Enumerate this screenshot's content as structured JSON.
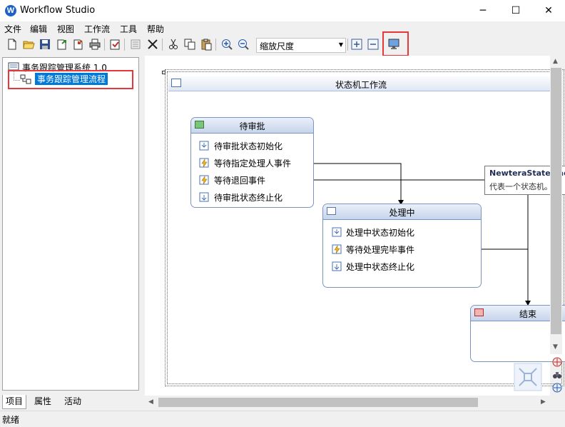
{
  "window": {
    "title": "Workflow Studio",
    "icon_letter": "W",
    "min": "─",
    "max": "☐",
    "close": "✕"
  },
  "menu": {
    "file": "文件",
    "edit": "编辑",
    "view": "视图",
    "workflow": "工作流",
    "tools": "工具",
    "help": "帮助"
  },
  "toolbar": {
    "zoom_label": "缩放尺度"
  },
  "tree": {
    "root": "事务跟踪管理系统 1.0",
    "child": "事务跟踪管理流程"
  },
  "tabs": {
    "project": "项目",
    "properties": "属性",
    "activity": "活动"
  },
  "designer": {
    "title": "状态机工作流",
    "states": [
      {
        "title": "待审批",
        "activities": [
          "待审批状态初始化",
          "等待指定处理人事件",
          "等待退回事件",
          "待审批状态终止化"
        ]
      },
      {
        "title": "处理中",
        "activities": [
          "处理中状态初始化",
          "等待处理完毕事件",
          "处理中状态终止化"
        ]
      },
      {
        "title": "结束"
      }
    ]
  },
  "tooltip": {
    "title": "NewteraStateMac",
    "desc": "代表一个状态机。"
  },
  "status": {
    "text": "就绪"
  },
  "colors": {
    "highlight": "#e8373a",
    "selection": "#0078d7",
    "state_border": "#7a95c2"
  }
}
